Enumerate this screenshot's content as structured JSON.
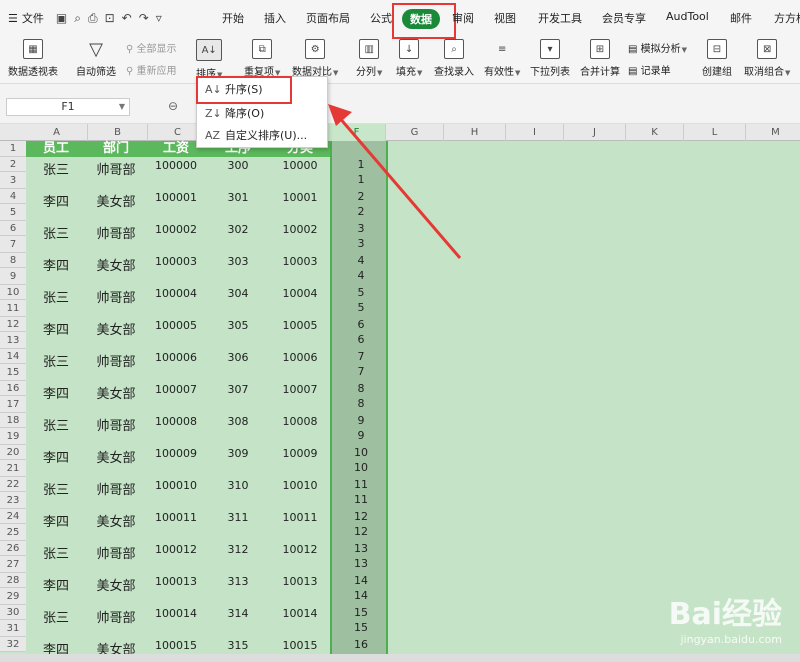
{
  "menubar": {
    "file_label": "文件",
    "tabs": [
      {
        "label": "开始",
        "active": false
      },
      {
        "label": "插入",
        "active": false
      },
      {
        "label": "页面布局",
        "active": false
      },
      {
        "label": "公式",
        "active": false
      },
      {
        "label": "数据",
        "active": true
      },
      {
        "label": "审阅",
        "active": false
      },
      {
        "label": "视图",
        "active": false
      },
      {
        "label": "开发工具",
        "active": false
      },
      {
        "label": "会员专享",
        "active": false
      },
      {
        "label": "AudTool",
        "active": false
      },
      {
        "label": "邮件",
        "active": false
      },
      {
        "label": "方方格",
        "active": false
      }
    ]
  },
  "ribbon": {
    "pivot": "数据透视表",
    "autofilter": "自动筛选",
    "show_all": "全部显示",
    "reapply": "重新应用",
    "sort": "排序",
    "duplicates": "重复项",
    "compare": "数据对比",
    "split": "分列",
    "fill": "填充",
    "lookup": "查找录入",
    "validity": "有效性",
    "dropdown_list": "下拉列表",
    "merge_calc": "合并计算",
    "simulate": "模拟分析",
    "record": "记录单",
    "group": "创建组",
    "ungroup": "取消组合"
  },
  "namebox": "F1",
  "columns": [
    "A",
    "B",
    "C",
    "D",
    "E",
    "F",
    "G",
    "H",
    "I",
    "J",
    "K",
    "L",
    "M"
  ],
  "header_row": [
    "员工",
    "部门",
    "工资",
    "工序",
    "分类"
  ],
  "rows": [
    {
      "row": 2,
      "name": "张三",
      "dept": "帅哥部",
      "salary": "100000",
      "proc": "300",
      "code": "10000"
    },
    {
      "row": 4,
      "name": "李四",
      "dept": "美女部",
      "salary": "100001",
      "proc": "301",
      "code": "10001"
    },
    {
      "row": 6,
      "name": "张三",
      "dept": "帅哥部",
      "salary": "100002",
      "proc": "302",
      "code": "10002"
    },
    {
      "row": 8,
      "name": "李四",
      "dept": "美女部",
      "salary": "100003",
      "proc": "303",
      "code": "10003"
    },
    {
      "row": 10,
      "name": "张三",
      "dept": "帅哥部",
      "salary": "100004",
      "proc": "304",
      "code": "10004"
    },
    {
      "row": 12,
      "name": "李四",
      "dept": "美女部",
      "salary": "100005",
      "proc": "305",
      "code": "10005"
    },
    {
      "row": 14,
      "name": "张三",
      "dept": "帅哥部",
      "salary": "100006",
      "proc": "306",
      "code": "10006"
    },
    {
      "row": 16,
      "name": "李四",
      "dept": "美女部",
      "salary": "100007",
      "proc": "307",
      "code": "10007"
    },
    {
      "row": 18,
      "name": "张三",
      "dept": "帅哥部",
      "salary": "100008",
      "proc": "308",
      "code": "10008"
    },
    {
      "row": 20,
      "name": "李四",
      "dept": "美女部",
      "salary": "100009",
      "proc": "309",
      "code": "10009"
    },
    {
      "row": 22,
      "name": "张三",
      "dept": "帅哥部",
      "salary": "100010",
      "proc": "310",
      "code": "10010"
    },
    {
      "row": 24,
      "name": "李四",
      "dept": "美女部",
      "salary": "100011",
      "proc": "311",
      "code": "10011"
    },
    {
      "row": 26,
      "name": "张三",
      "dept": "帅哥部",
      "salary": "100012",
      "proc": "312",
      "code": "10012"
    },
    {
      "row": 28,
      "name": "李四",
      "dept": "美女部",
      "salary": "100013",
      "proc": "313",
      "code": "10013"
    },
    {
      "row": 30,
      "name": "张三",
      "dept": "帅哥部",
      "salary": "100014",
      "proc": "314",
      "code": "10014"
    },
    {
      "row": 32,
      "name": "李四",
      "dept": "美女部",
      "salary": "100015",
      "proc": "315",
      "code": "10015"
    }
  ],
  "f_column": [
    "1",
    "1",
    "2",
    "2",
    "3",
    "3",
    "4",
    "4",
    "5",
    "5",
    "6",
    "6",
    "7",
    "7",
    "8",
    "8",
    "9",
    "9",
    "10",
    "10",
    "11",
    "11",
    "12",
    "12",
    "13",
    "13",
    "14",
    "14",
    "15",
    "15",
    "16"
  ],
  "sort_menu": {
    "asc": "升序(S)",
    "desc": "降序(O)",
    "custom": "自定义排序(U)..."
  },
  "watermark": {
    "brand": "Bai经验",
    "url": "jingyan.baidu.com"
  },
  "colors": {
    "accent": "#1a8a3a",
    "highlight": "#e53935",
    "header_fill": "#5cb85c"
  }
}
